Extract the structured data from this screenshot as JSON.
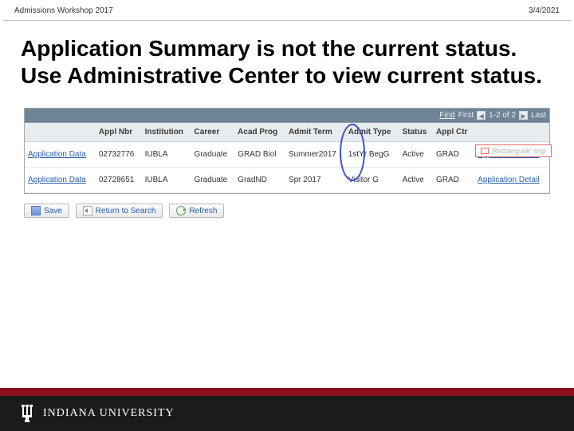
{
  "header": {
    "left": "Admissions Workshop 2017",
    "right": "3/4/2021"
  },
  "title": "Application Summary is not the current status.  Use Administrative Center to view current status.",
  "grid": {
    "find": "Find",
    "first": "First",
    "range": "1-2 of 2",
    "last": "Last",
    "headers": {
      "blank": "",
      "appl_nbr": "Appl Nbr",
      "institution": "Institution",
      "career": "Career",
      "acad_prog": "Acad Prog",
      "admit_term": "Admit Term",
      "admit_type": "Admit Type",
      "status": "Status",
      "appl_ctr": "Appl Ctr",
      "detail": ""
    },
    "rows": [
      {
        "link": "Application Data",
        "appl_nbr": "02732776",
        "institution": "IUBLA",
        "career": "Graduate",
        "acad_prog": "GRAD Biol",
        "admit_term": "Summer2017",
        "admit_type": "1stYr BegG",
        "status": "Active",
        "appl_ctr": "GRAD",
        "detail": "Application Detail"
      },
      {
        "link": "Application Data",
        "appl_nbr": "02728651",
        "institution": "IUBLA",
        "career": "Graduate",
        "acad_prog": "GradND",
        "admit_term": "Spr 2017",
        "admit_type": "Visitor G",
        "status": "Active",
        "appl_ctr": "GRAD",
        "detail": "Application Detail"
      }
    ]
  },
  "snip_label": "Rectangular snip",
  "toolbar": {
    "save": "Save",
    "return": "Return to Search",
    "refresh": "Refresh"
  },
  "footer": {
    "brand": "INDIANA UNIVERSITY"
  }
}
